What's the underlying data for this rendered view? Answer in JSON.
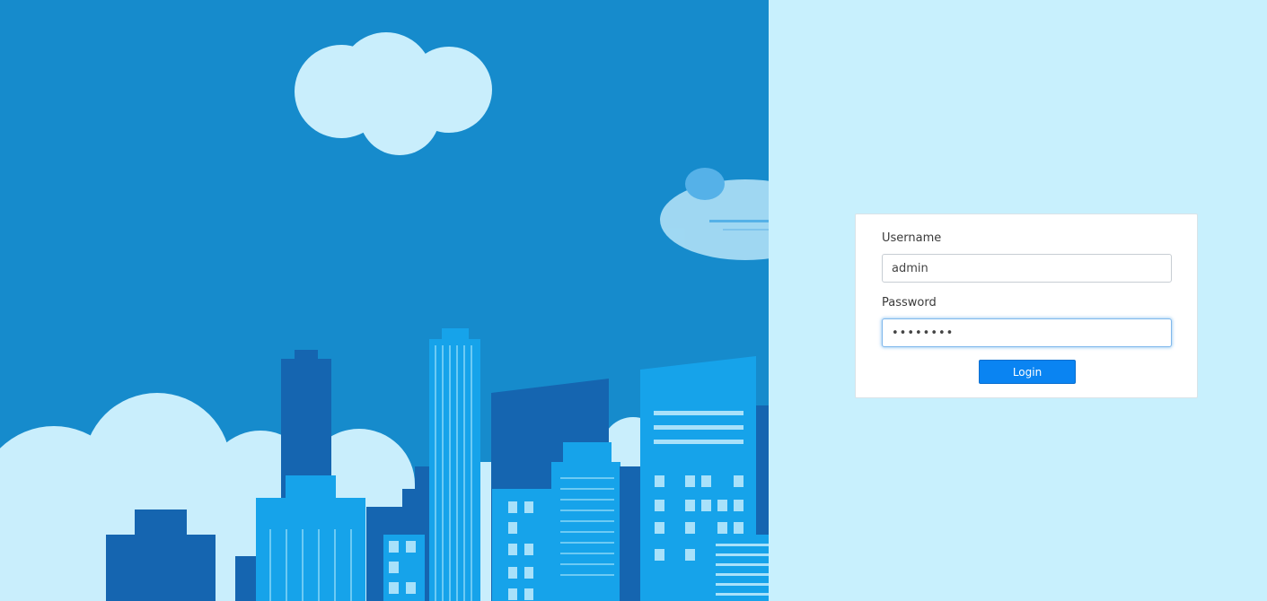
{
  "login_form": {
    "username_label": "Username",
    "username_value": "admin",
    "password_label": "Password",
    "password_value": "••••••••",
    "login_button_label": "Login"
  },
  "colors": {
    "sky": "#168bcc",
    "page_background": "#c8f0fd",
    "button": "#0a84f2",
    "cloud": "#c9eefc"
  },
  "illustration": {
    "name": "city-skyline-illustration"
  }
}
